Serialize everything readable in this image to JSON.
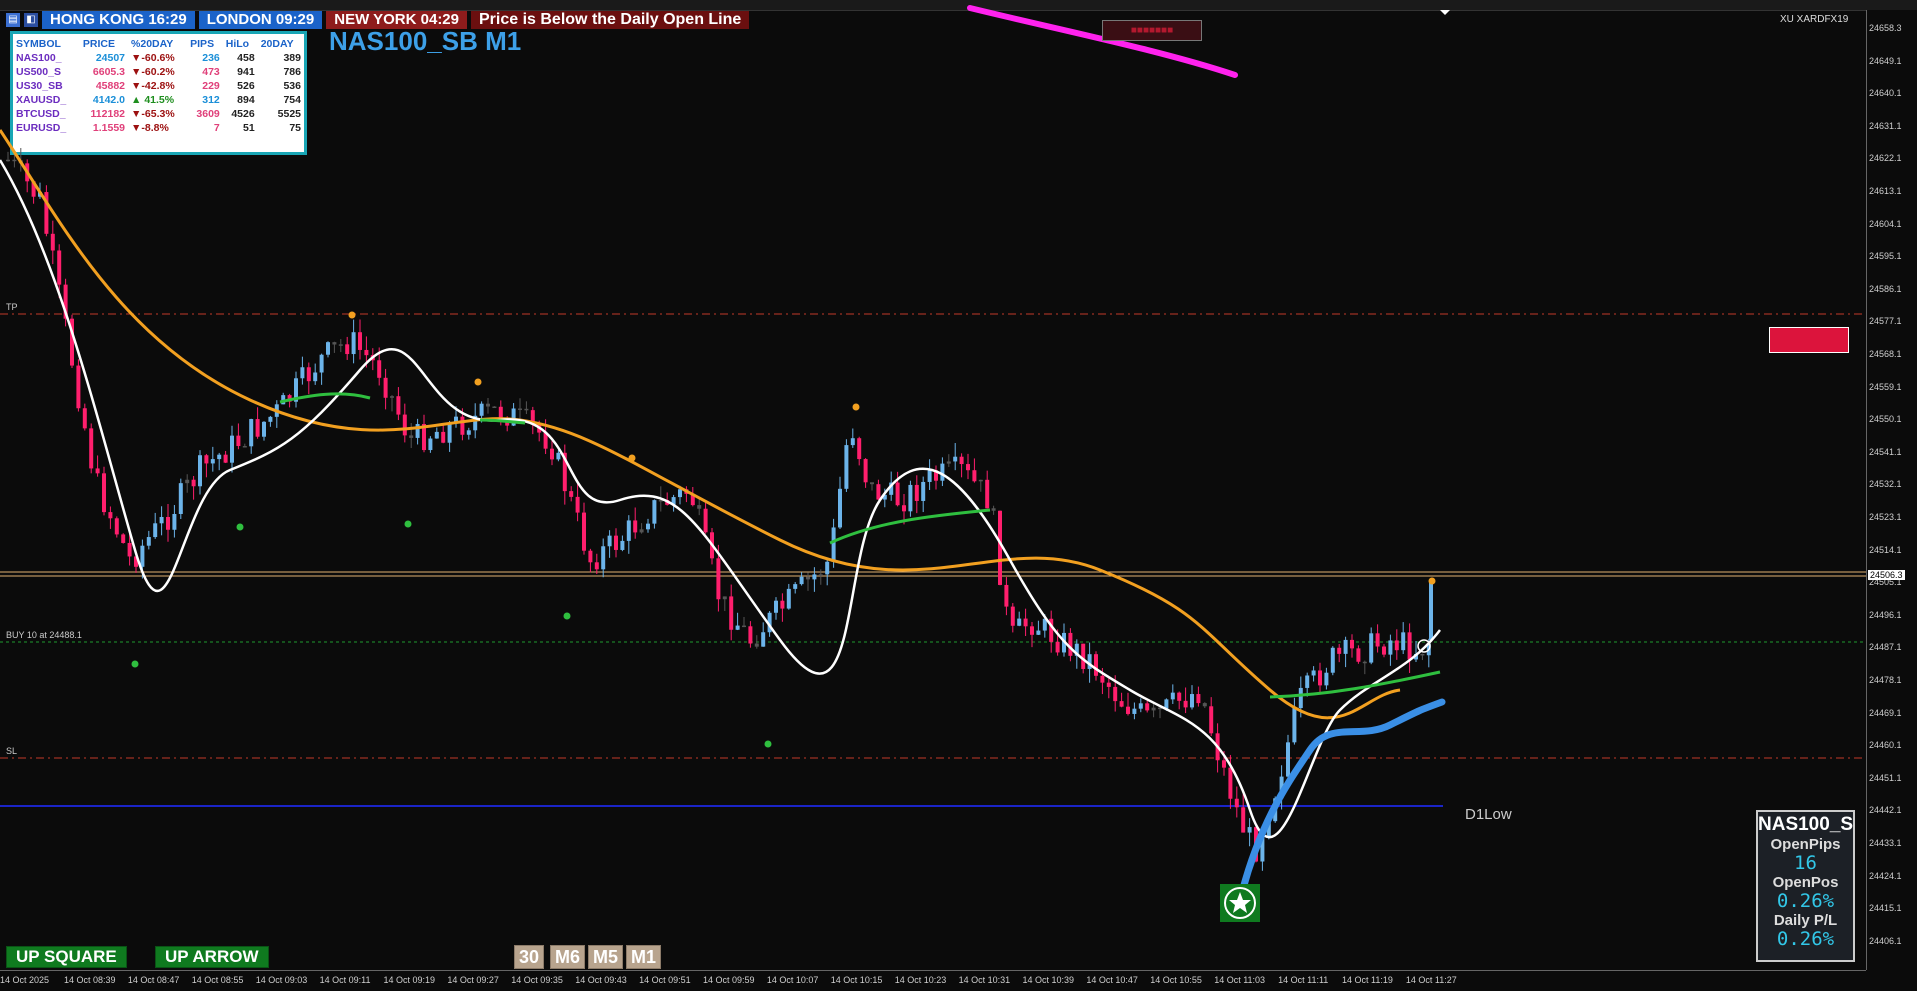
{
  "clocks": [
    {
      "label": "HONG KONG 16:29",
      "color": "#1b63c9"
    },
    {
      "label": "LONDON  09:29",
      "color": "#1b63c9"
    },
    {
      "label": "NEW YORK  04:29",
      "color": "#8e1c1c"
    }
  ],
  "alert": "Price is Below the Daily Open Line",
  "symbol_table": {
    "headers": [
      "SYMBOL",
      "PRICE",
      "%20DAY",
      "PIPS",
      "HiLo",
      "20DAY"
    ],
    "rows": [
      {
        "symbol": "NAS100_",
        "price": "24507",
        "change": "-60.6%",
        "dir": "down",
        "pips": "236",
        "hilo": "458",
        "day20": "389"
      },
      {
        "symbol": "US500_S",
        "price": "6605.3",
        "change": "-60.2%",
        "dir": "down",
        "pips": "473",
        "hilo": "941",
        "day20": "786"
      },
      {
        "symbol": "US30_SB",
        "price": "45882",
        "change": "-42.8%",
        "dir": "down",
        "pips": "229",
        "hilo": "526",
        "day20": "536"
      },
      {
        "symbol": "XAUUSD_",
        "price": "4142.0",
        "change": "41.5%",
        "dir": "up",
        "pips": "312",
        "hilo": "894",
        "day20": "754"
      },
      {
        "symbol": "BTCUSD_",
        "price": "112182",
        "change": "-65.3%",
        "dir": "down",
        "pips": "3609",
        "hilo": "4526",
        "day20": "5525"
      },
      {
        "symbol": "EURUSD_",
        "price": "1.1559",
        "change": "-8.8%",
        "dir": "down",
        "pips": "7",
        "hilo": "51",
        "day20": "75"
      }
    ]
  },
  "chart": {
    "title": "NAS100_SB M1",
    "broker": "XU XARDFX19",
    "price_ticks": [
      "24658.3",
      "24649.1",
      "24640.1",
      "24631.1",
      "24622.1",
      "24613.1",
      "24604.1",
      "24595.1",
      "24586.1",
      "24577.1",
      "24568.1",
      "24559.1",
      "24550.1",
      "24541.1",
      "24532.1",
      "24523.1",
      "24514.1",
      "24505.1",
      "24496.1",
      "24487.1",
      "24478.1",
      "24469.1",
      "24460.1",
      "24451.1",
      "24442.1",
      "24433.1",
      "24424.1",
      "24415.1",
      "24406.1"
    ],
    "current_price": "24506.3",
    "time_ticks": [
      "14 Oct 2025",
      "14 Oct 08:39",
      "14 Oct 08:47",
      "14 Oct 08:55",
      "14 Oct 09:03",
      "14 Oct 09:11",
      "14 Oct 09:19",
      "14 Oct 09:27",
      "14 Oct 09:35",
      "14 Oct 09:43",
      "14 Oct 09:51",
      "14 Oct 09:59",
      "14 Oct 10:07",
      "14 Oct 10:15",
      "14 Oct 10:23",
      "14 Oct 10:31",
      "14 Oct 10:39",
      "14 Oct 10:47",
      "14 Oct 10:55",
      "14 Oct 11:03",
      "14 Oct 11:11",
      "14 Oct 11:19",
      "14 Oct 11:27"
    ],
    "tp_label": "TP",
    "sl_label": "SL",
    "buy_label": "BUY 10 at 24488.1",
    "d1low_label": "D1Low",
    "colors": {
      "bull": "#6cb4ea",
      "bear": "#ff1f6d",
      "neutral": "#555555",
      "ema_slow": "#f2a020",
      "ema_fast": "#ffffff",
      "blue_ma": "#3a8fe6",
      "green_ma": "#2fbf3f",
      "magenta": "#ff22ee"
    }
  },
  "position_panel": {
    "symbol": "NAS100_S",
    "open_pips_label": "OpenPips",
    "open_pips": "16",
    "open_pos_label": "OpenPos",
    "open_pos": "0.26%",
    "daily_pl_label": "Daily P/L",
    "daily_pl": "0.26%"
  },
  "buttons": {
    "up_square": "UP SQUARE",
    "up_arrow": "UP ARROW",
    "timeframes": [
      "30",
      "M6",
      "M5",
      "M1"
    ]
  }
}
